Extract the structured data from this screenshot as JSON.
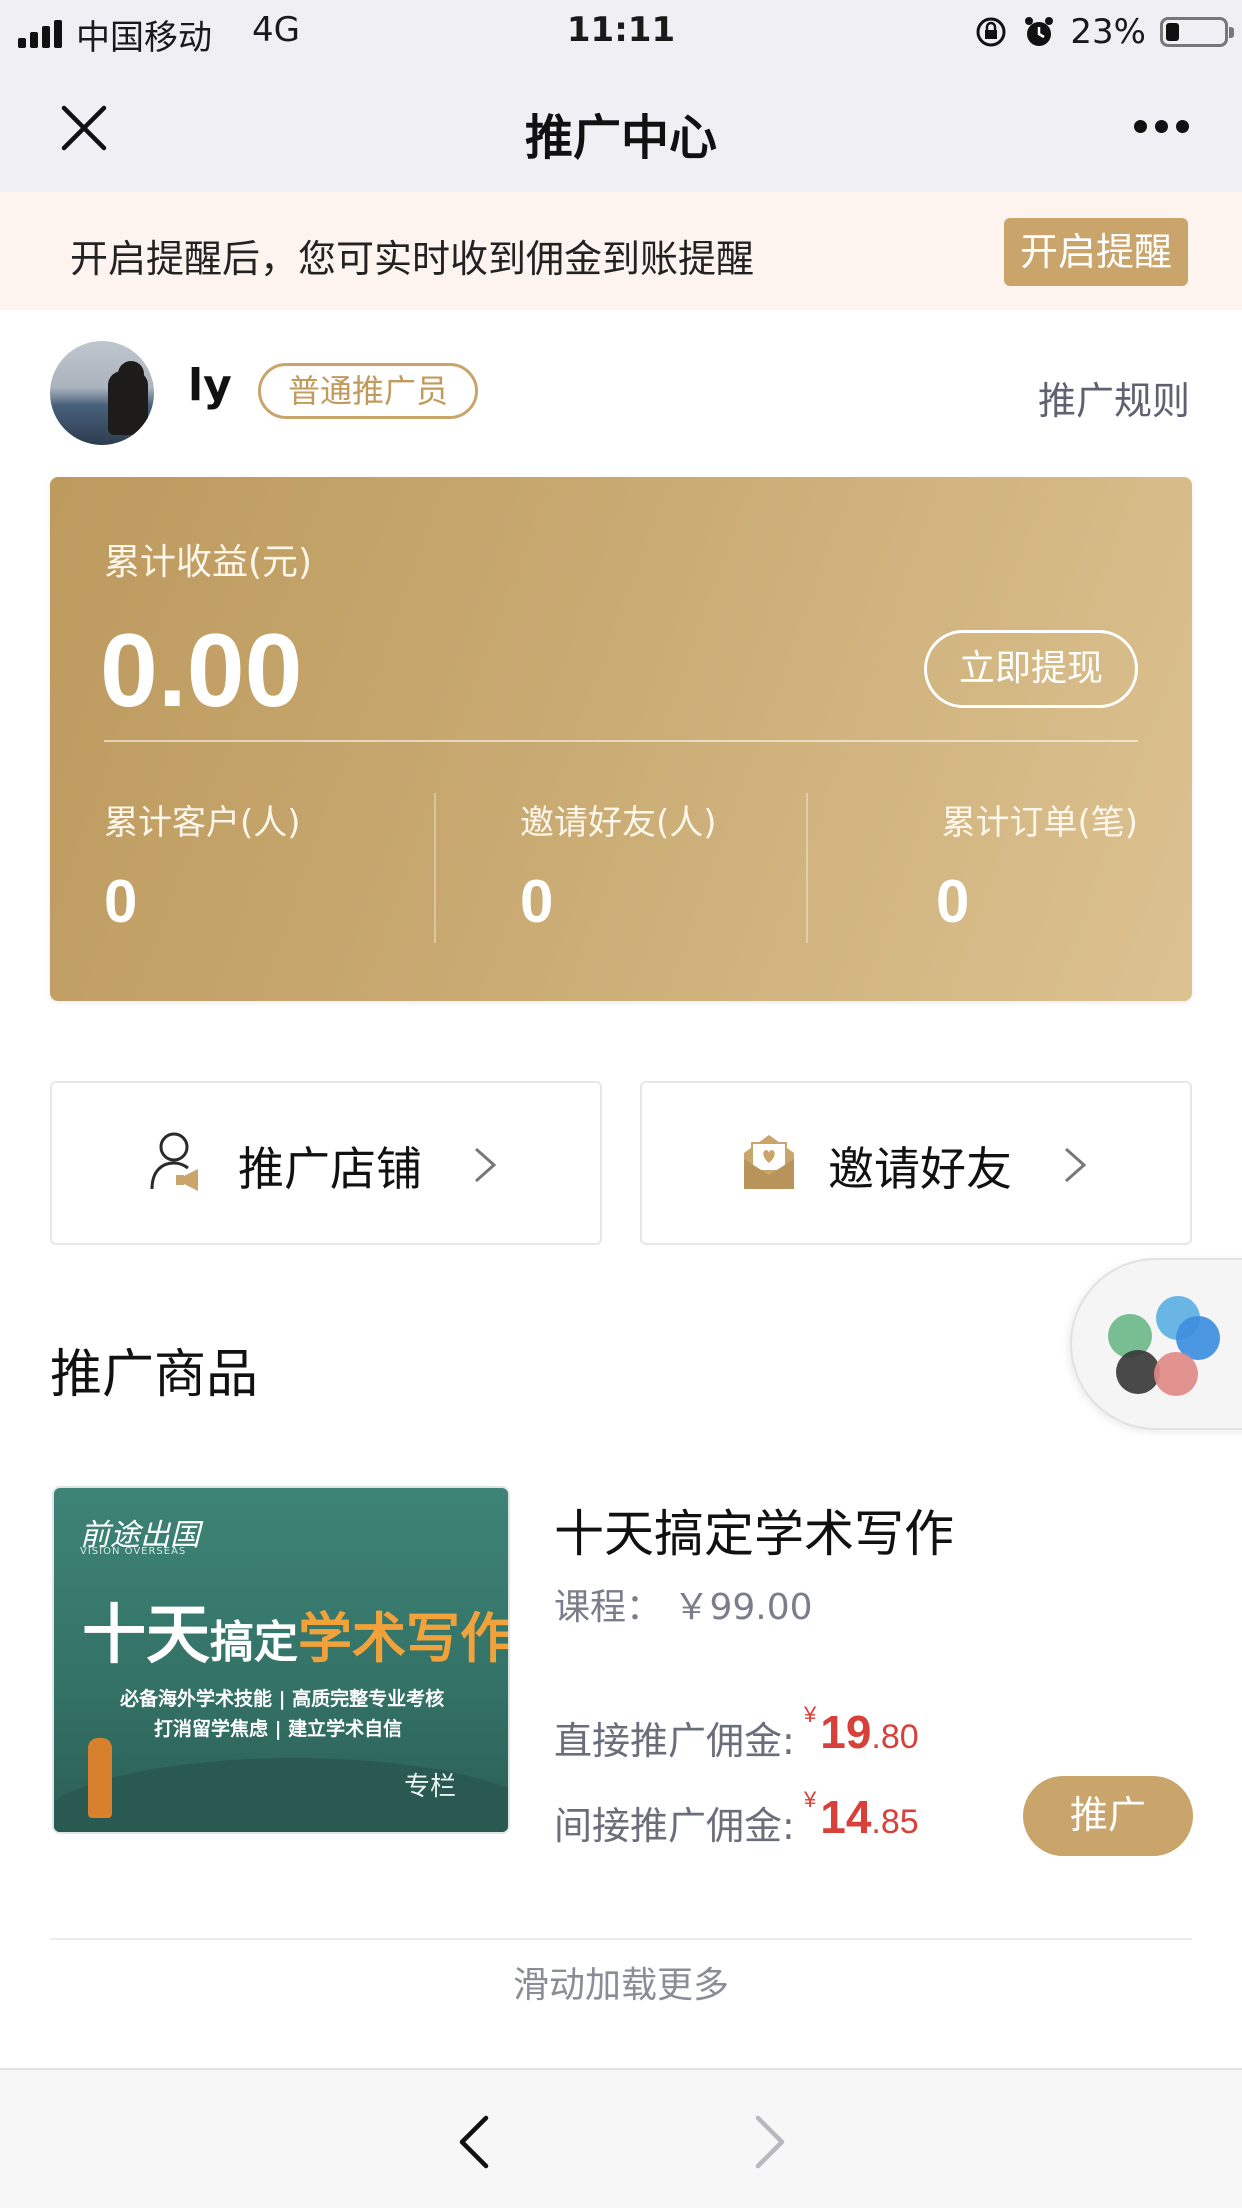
{
  "status_bar": {
    "carrier": "中国移动",
    "network": "4G",
    "time": "11:11",
    "battery_percent": "23%",
    "battery_level": 0.23
  },
  "nav": {
    "title": "推广中心",
    "close_icon": "close-icon",
    "more_icon": "more-icon"
  },
  "banner": {
    "text": "开启提醒后，您可实时收到佣金到账提醒",
    "button_label": "开启提醒"
  },
  "profile": {
    "username": "ly",
    "level_badge": "普通推广员",
    "rules_link": "推广规则"
  },
  "earnings": {
    "label": "累计收益(元)",
    "amount": "0.00",
    "withdraw_label": "立即提现",
    "stats": [
      {
        "label": "累计客户(人)",
        "value": "0"
      },
      {
        "label": "邀请好友(人)",
        "value": "0"
      },
      {
        "label": "累计订单(笔)",
        "value": "0"
      }
    ]
  },
  "actions": [
    {
      "label": "推广店铺",
      "icon": "person-megaphone-icon"
    },
    {
      "label": "邀请好友",
      "icon": "envelope-heart-icon"
    }
  ],
  "section": {
    "title": "推广商品"
  },
  "product": {
    "thumb": {
      "logo": "前途出国",
      "logo_sub": "VISION OVERSEAS",
      "title_part1": "十天",
      "title_part2": "搞定",
      "title_part3": "学术写作",
      "line1": "必备海外学术技能 | 高质完整专业考核",
      "line2": "打消留学焦虑 | 建立学术自信",
      "tag": "专栏"
    },
    "title": "十天搞定学术写作",
    "price": "课程：  ￥99.00",
    "direct_label": "直接推广佣金:",
    "direct_yen": "¥",
    "direct_int": "19",
    "direct_dec": ".80",
    "indirect_label": "间接推广佣金:",
    "indirect_yen": "¥",
    "indirect_int": "14",
    "indirect_dec": ".85",
    "promote_label": "推广"
  },
  "list_footer": {
    "load_more": "滑动加载更多"
  },
  "colors": {
    "accent_gold": "#c9a46b",
    "price_red": "#d8403a"
  }
}
